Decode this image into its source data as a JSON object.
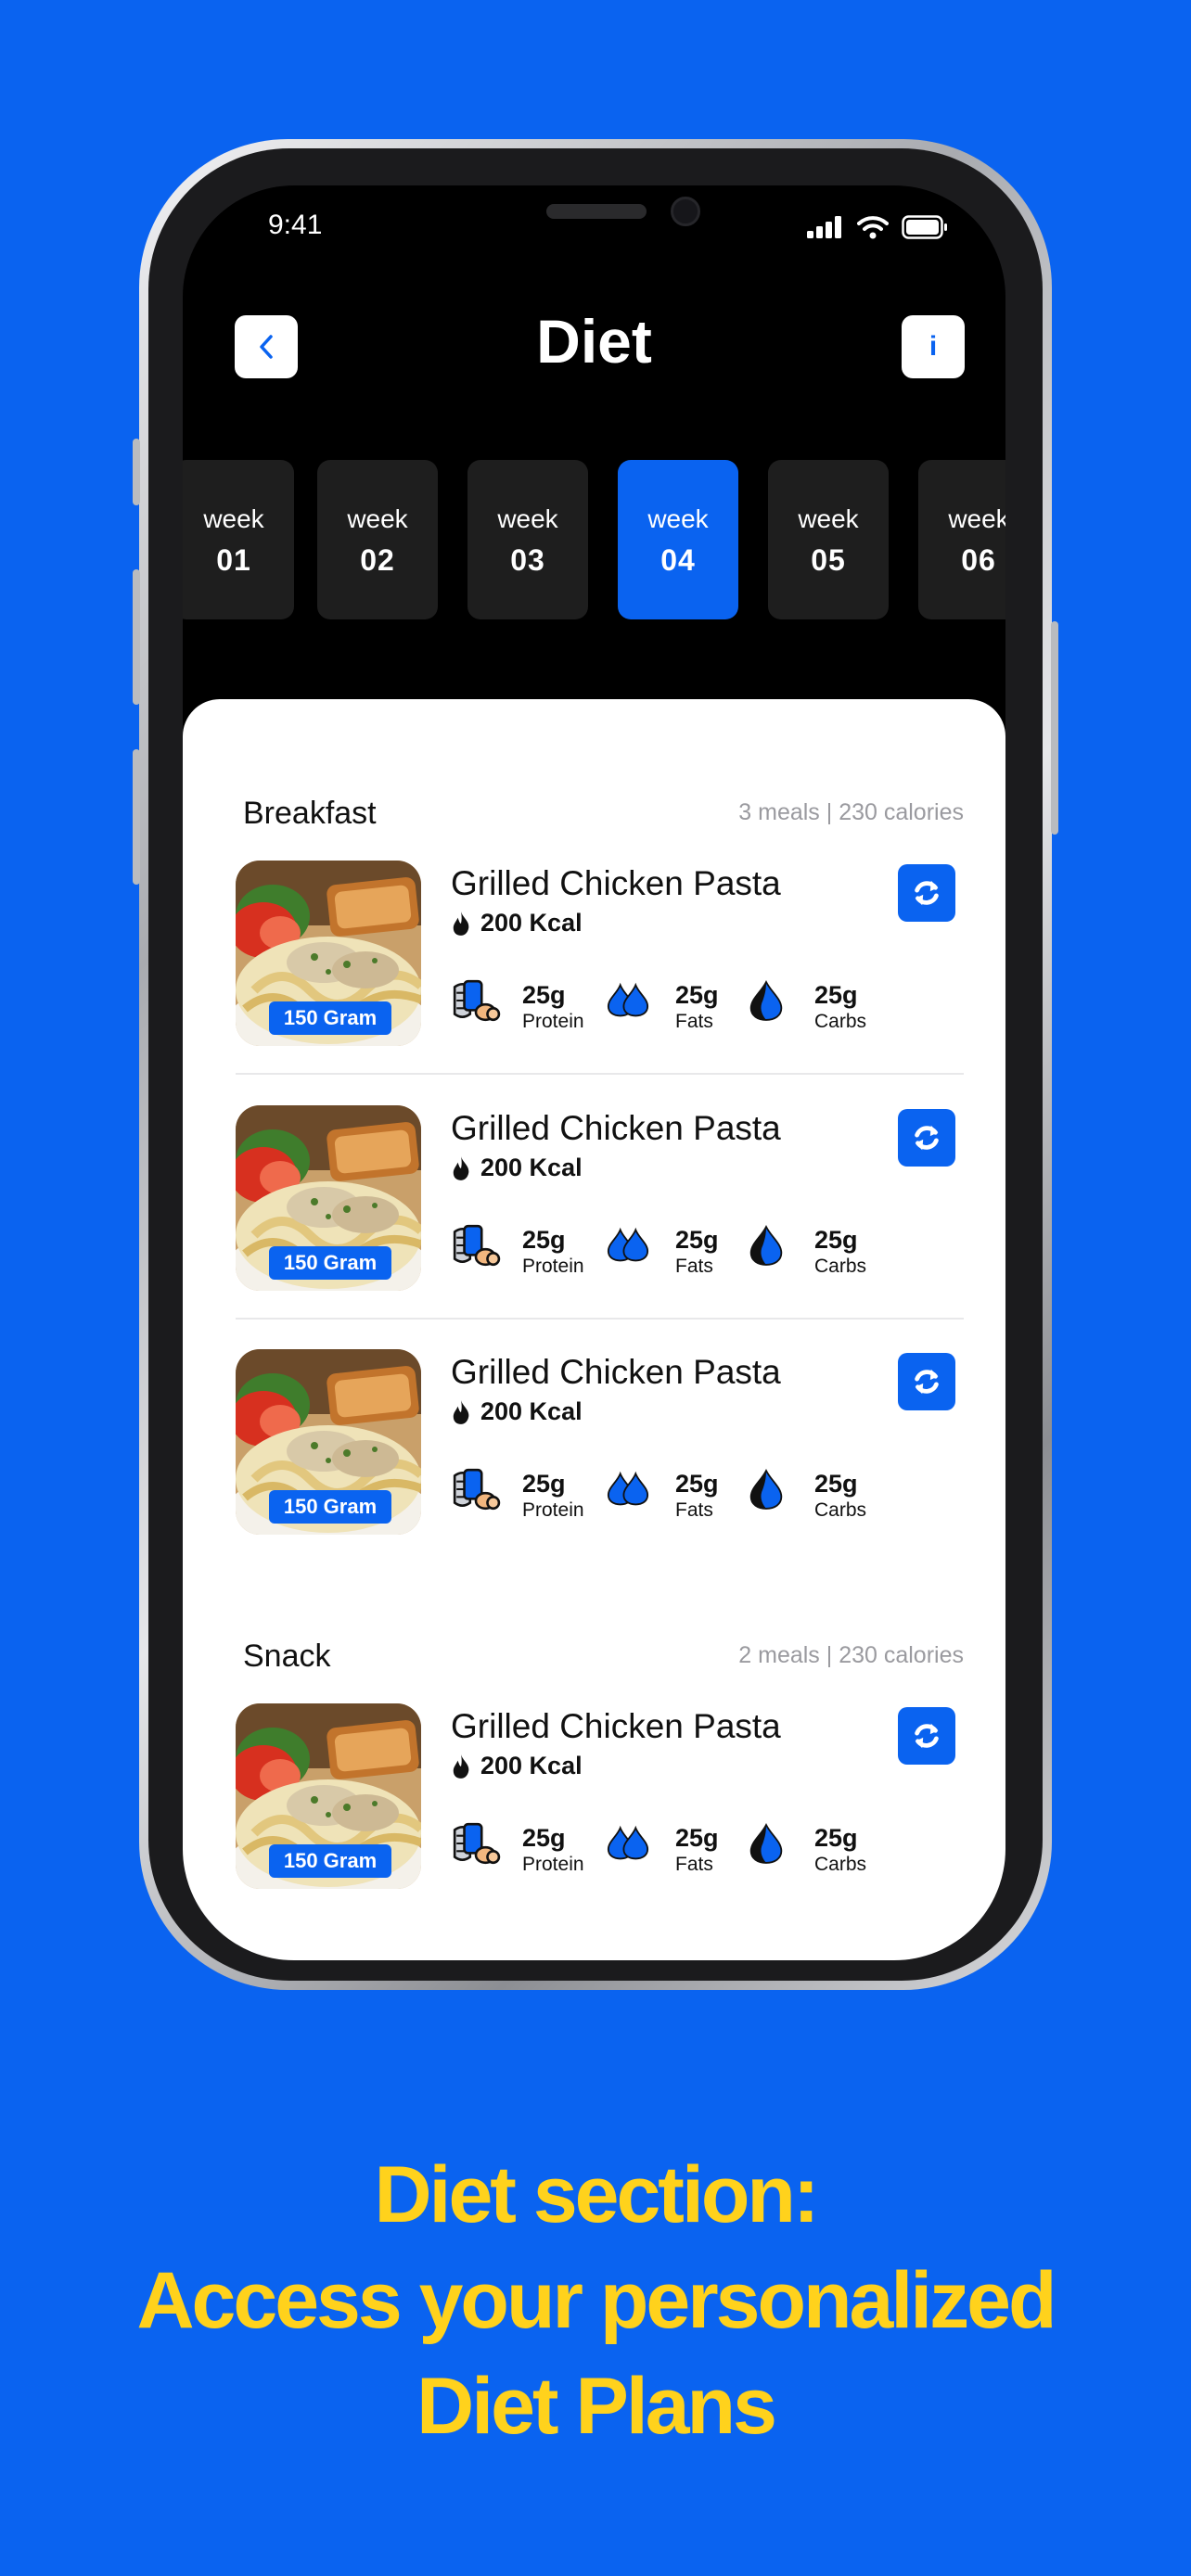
{
  "status": {
    "time": "9:41"
  },
  "header": {
    "title": "Diet",
    "info_label": "i"
  },
  "weeks": [
    {
      "label": "week",
      "num": "01"
    },
    {
      "label": "week",
      "num": "02"
    },
    {
      "label": "week",
      "num": "03"
    },
    {
      "label": "week",
      "num": "04",
      "selected": true
    },
    {
      "label": "week",
      "num": "05"
    },
    {
      "label": "week",
      "num": "06"
    }
  ],
  "sections": {
    "breakfast": {
      "title": "Breakfast",
      "meta": "3 meals | 230 calories",
      "meals": [
        {
          "name": "Grilled Chicken Pasta",
          "kcal": "200 Kcal",
          "weight": "150 Gram",
          "macros": {
            "protein": {
              "value": "25g",
              "label": "Protein"
            },
            "fats": {
              "value": "25g",
              "label": "Fats"
            },
            "carbs": {
              "value": "25g",
              "label": "Carbs"
            }
          }
        },
        {
          "name": "Grilled Chicken Pasta",
          "kcal": "200 Kcal",
          "weight": "150 Gram",
          "macros": {
            "protein": {
              "value": "25g",
              "label": "Protein"
            },
            "fats": {
              "value": "25g",
              "label": "Fats"
            },
            "carbs": {
              "value": "25g",
              "label": "Carbs"
            }
          }
        },
        {
          "name": "Grilled Chicken Pasta",
          "kcal": "200 Kcal",
          "weight": "150 Gram",
          "macros": {
            "protein": {
              "value": "25g",
              "label": "Protein"
            },
            "fats": {
              "value": "25g",
              "label": "Fats"
            },
            "carbs": {
              "value": "25g",
              "label": "Carbs"
            }
          }
        }
      ]
    },
    "snack": {
      "title": "Snack",
      "meta": "2 meals | 230 calories",
      "meals": [
        {
          "name": "Grilled Chicken Pasta",
          "kcal": "200 Kcal",
          "weight": "150 Gram",
          "macros": {
            "protein": {
              "value": "25g",
              "label": "Protein"
            },
            "fats": {
              "value": "25g",
              "label": "Fats"
            },
            "carbs": {
              "value": "25g",
              "label": "Carbs"
            }
          }
        }
      ]
    }
  },
  "caption": {
    "line1": "Diet section:",
    "line2": "Access your personalized",
    "line3": "Diet Plans"
  },
  "colors": {
    "brand_blue": "#0a63f0",
    "caption_yellow": "#ffd21c"
  },
  "icons": [
    "chevron-left-icon",
    "info-icon",
    "refresh-icon",
    "flame-icon",
    "protein-icon",
    "fats-drops-icon",
    "carbs-drop-icon",
    "signal-icon",
    "wifi-icon",
    "battery-icon"
  ]
}
